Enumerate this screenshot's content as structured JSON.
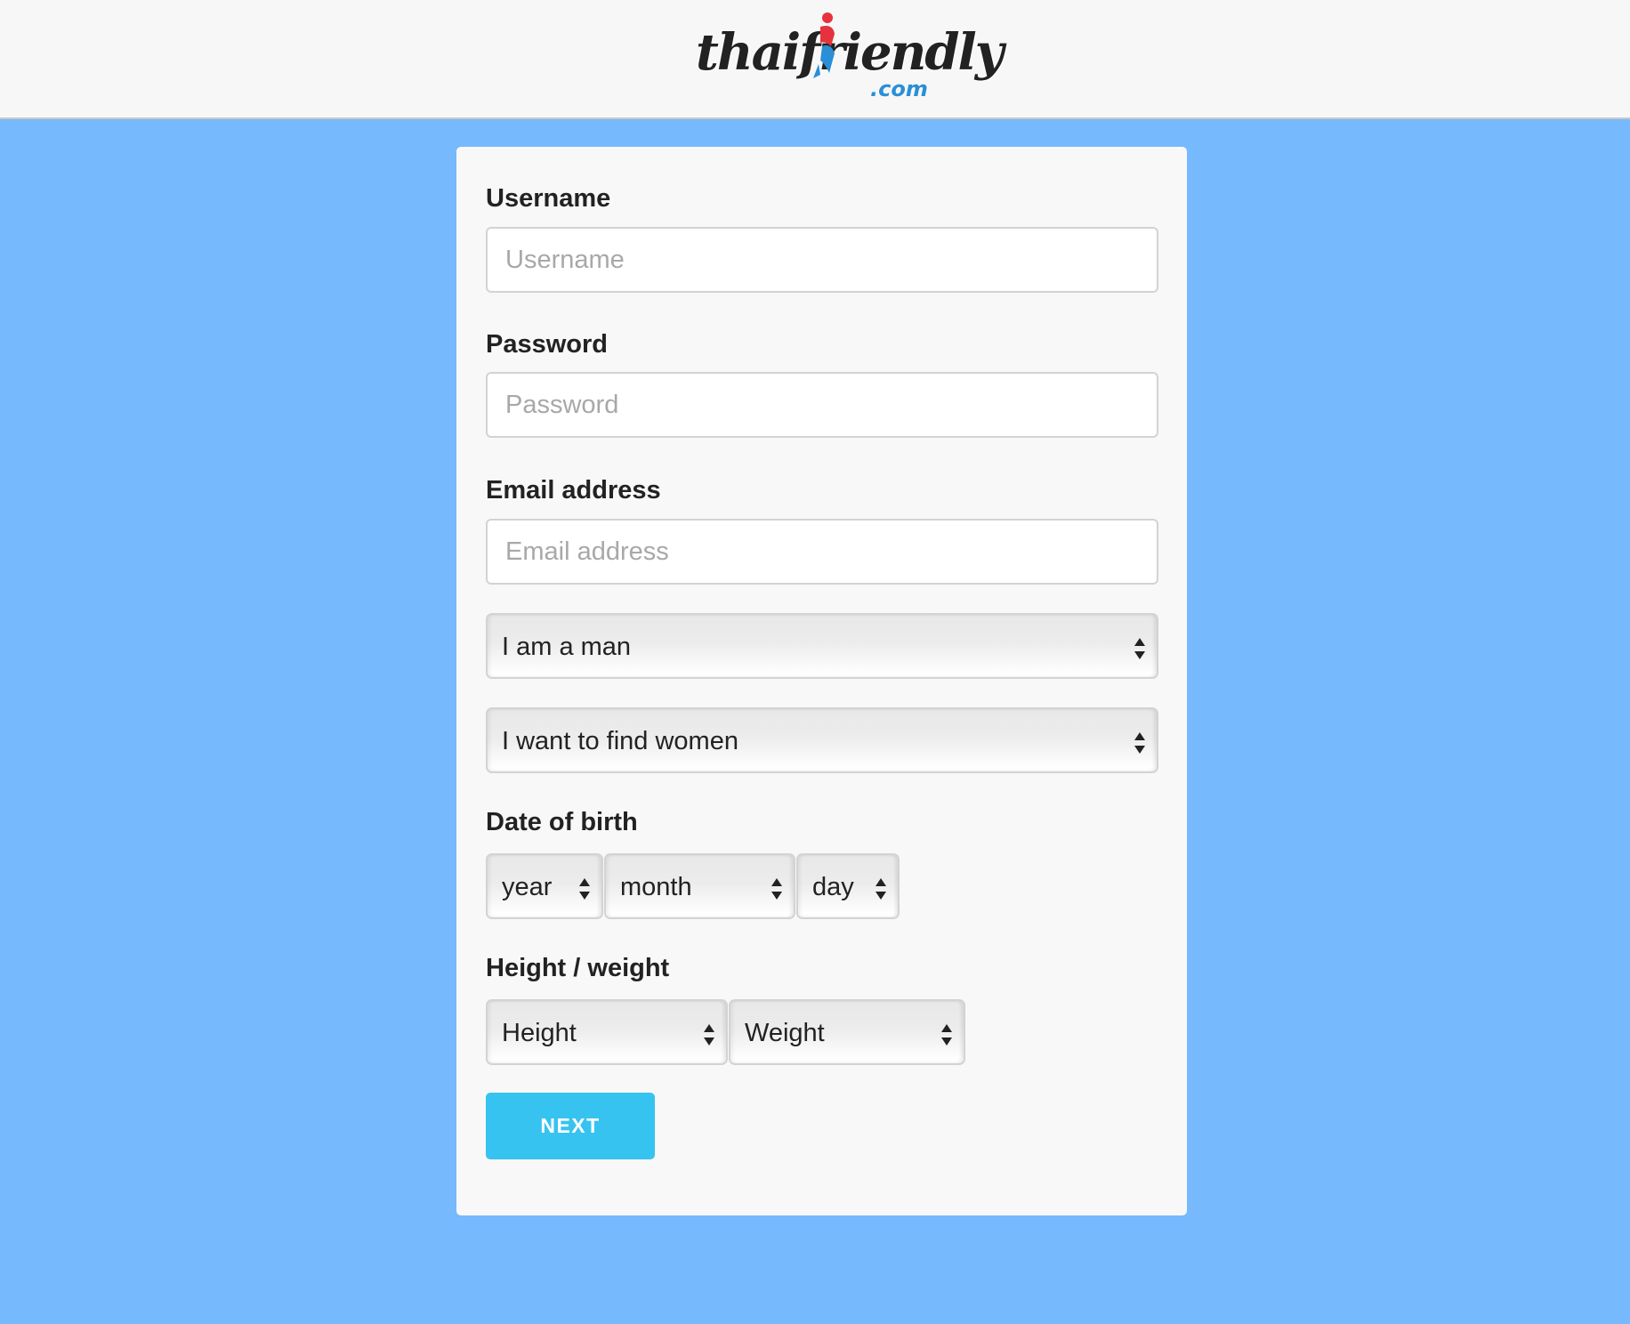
{
  "header": {
    "logo": {
      "wordmark": "thaifriendly",
      "suffix": ".com"
    }
  },
  "form": {
    "username": {
      "label": "Username",
      "placeholder": "Username",
      "value": ""
    },
    "password": {
      "label": "Password",
      "placeholder": "Password",
      "value": ""
    },
    "email": {
      "label": "Email address",
      "placeholder": "Email address",
      "value": ""
    },
    "gender_select": {
      "selected": "I am a man",
      "icon": "updown-arrows-icon"
    },
    "seeking_select": {
      "selected": "I want to find women",
      "icon": "updown-arrows-icon"
    },
    "dob": {
      "label": "Date of birth",
      "year": {
        "selected": "year"
      },
      "month": {
        "selected": "month"
      },
      "day": {
        "selected": "day"
      }
    },
    "height_weight": {
      "label": "Height / weight",
      "height": {
        "selected": "Height"
      },
      "weight": {
        "selected": "Weight"
      }
    },
    "next_button": {
      "label": "NEXT"
    }
  },
  "colors": {
    "page_background": "#77b9fd",
    "header_background": "#f7f7f7",
    "card_background": "#f8f8f8",
    "button_accent": "#36c3f0",
    "logo_red": "#e6323c",
    "logo_blue": "#2a8fd6"
  }
}
